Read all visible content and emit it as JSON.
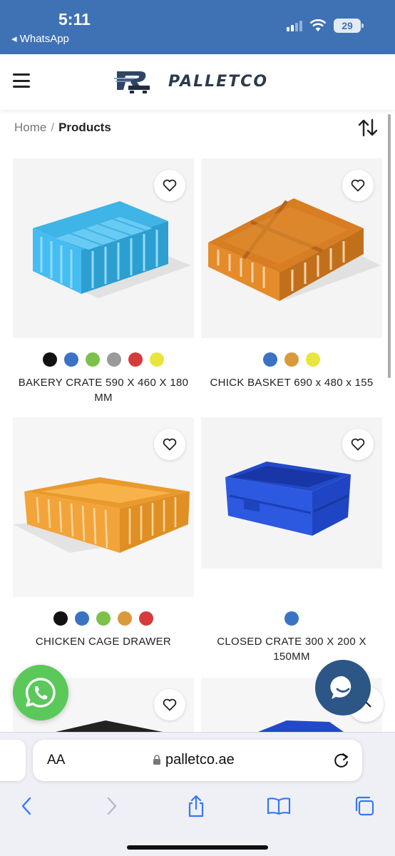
{
  "status_bar": {
    "time": "5:11",
    "back_label": "◂ WhatsApp",
    "battery": "29"
  },
  "header": {
    "logo_text": "PALLETCO"
  },
  "breadcrumb": {
    "home": "Home",
    "separator": "/",
    "current": "Products"
  },
  "products": [
    {
      "title": "BAKERY CRATE 590 X 460 X 180 MM",
      "swatches": [
        "#111111",
        "#3a73c4",
        "#7cc24a",
        "#9a9a9a",
        "#d63b3b",
        "#e8e53e"
      ]
    },
    {
      "title": "CHICK BASKET 690 x 480 x 155",
      "swatches": [
        "#3a73c4",
        "#d99a3c",
        "#e8e53e"
      ]
    },
    {
      "title": "CHICKEN CAGE DRAWER",
      "swatches": [
        "#111111",
        "#3a73c4",
        "#7cc24a",
        "#d99a3c",
        "#d63b3b"
      ]
    },
    {
      "title": "CLOSED CRATE 300 X 200 X 150MM",
      "swatches": [
        "#3a73c4"
      ]
    }
  ],
  "browser": {
    "aa_label": "AA",
    "url": "palletco.ae"
  },
  "icons": [
    "hamburger-icon",
    "sort-icon",
    "heart-icon",
    "whatsapp-icon",
    "chat-icon",
    "chevron-up-icon",
    "lock-icon",
    "reload-icon",
    "back-icon",
    "forward-icon",
    "share-icon",
    "bookmarks-icon",
    "tabs-icon"
  ],
  "colors": {
    "status_bar": "#3f72b5",
    "whatsapp": "#5bc85a",
    "chat": "#2b5686"
  }
}
